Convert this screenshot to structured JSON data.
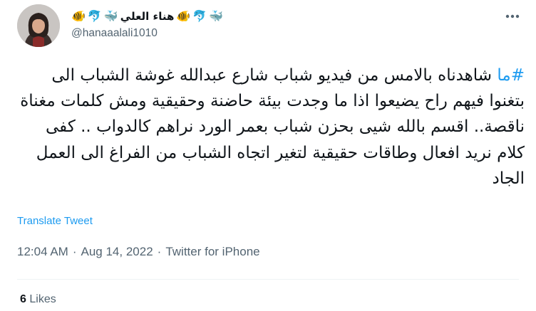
{
  "tweet": {
    "author": {
      "display_name": "هناء العلي",
      "name_emojis_before": [
        "🐳",
        "🐬",
        "🐠"
      ],
      "name_emojis_after": [
        "🐳",
        "🐬",
        "🐠"
      ],
      "handle": "@hanaaalali1010"
    },
    "text": {
      "hashtag": "#ما",
      "body": " شاهدناه بالامس من فيديو شباب شارع عبدالله غوشة الشباب الى بتغنوا فيهم راح يضيعوا اذا ما وجدت بيئة حاضنة وحقيقية ومش كلمات مغناة ناقصة.. اقسم بالله شيى بحزن شباب بعمر الورد نراهم كالدواب .. كفى كلام نريد افعال وطاقات حقيقية لتغير اتجاه الشباب من الفراغ الى العمل الجاد"
    },
    "translate_label": "Translate Tweet",
    "meta": {
      "time": "12:04 AM",
      "separator": "·",
      "date": "Aug 14, 2022",
      "source": "Twitter for iPhone"
    },
    "stats": {
      "likes_count": "6",
      "likes_label": "Likes"
    }
  },
  "colors": {
    "link": "#1d9bf0",
    "secondary_text": "#536471",
    "primary_text": "#0f1419",
    "divider": "#eff3f4"
  },
  "icons": {
    "more": "more-horizontal-icon"
  }
}
